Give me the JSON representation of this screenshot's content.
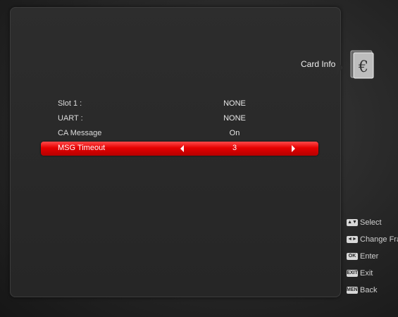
{
  "header": {
    "title": "Card Info"
  },
  "rows": [
    {
      "label": "Slot 1 :",
      "value": "NONE"
    },
    {
      "label": "UART :",
      "value": "NONE"
    },
    {
      "label": "CA Message",
      "value": "On"
    },
    {
      "label": "MSG Timeout",
      "value": "3",
      "selected": true
    }
  ],
  "help": [
    {
      "key": "▲▼",
      "label": "Select"
    },
    {
      "key": "◄►",
      "label": "Change Fran"
    },
    {
      "key": "OK",
      "label": "Enter"
    },
    {
      "key": "EXIT",
      "label": "Exit"
    },
    {
      "key": "MENU",
      "label": "Back"
    }
  ],
  "colors": {
    "highlight": "#e40000",
    "panel": "#2d2d2d"
  },
  "icons": {
    "card": "card-euro-icon"
  }
}
